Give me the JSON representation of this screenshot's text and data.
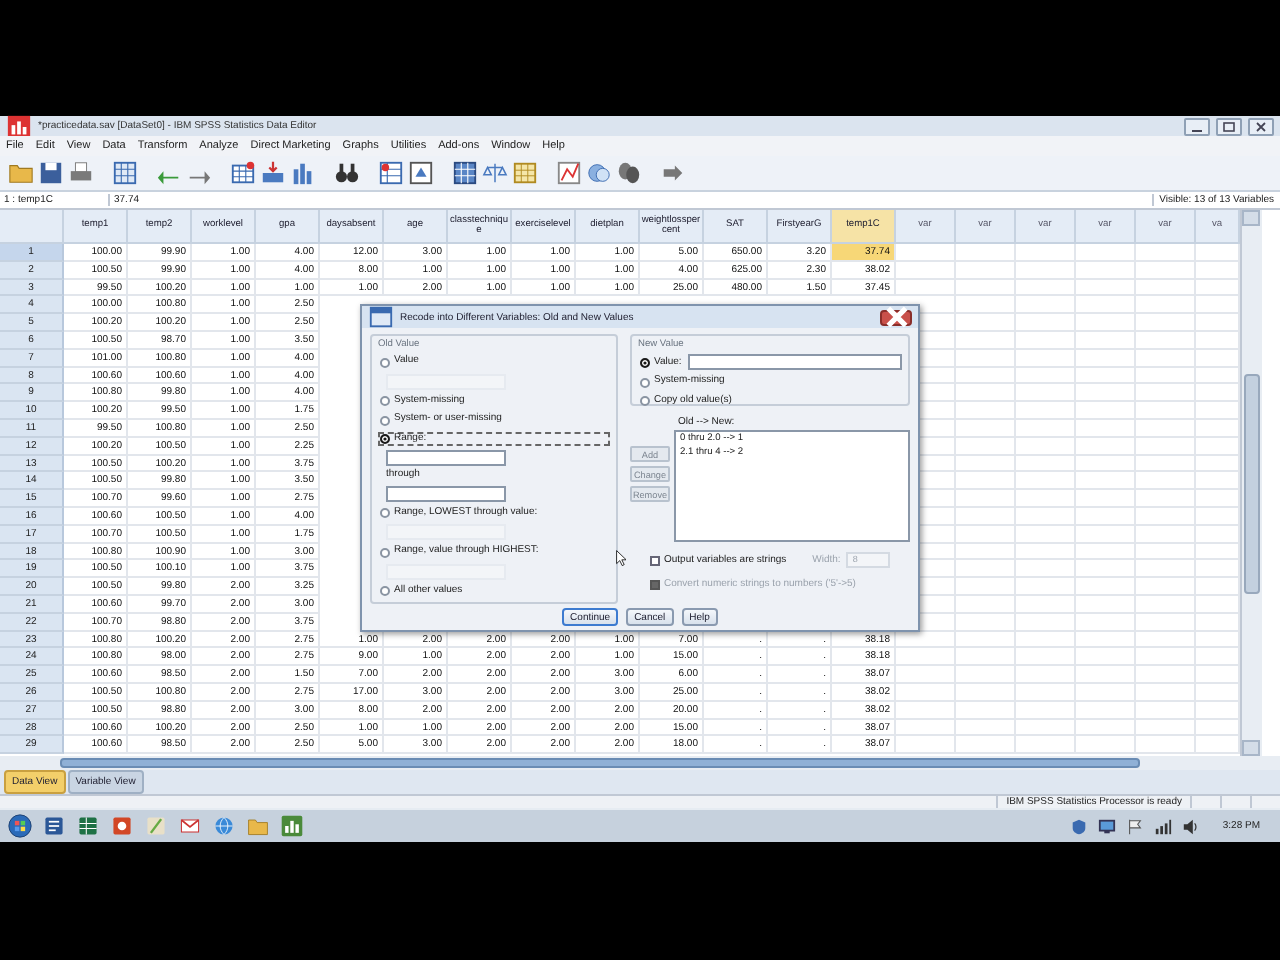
{
  "window": {
    "title": "*practicedata.sav [DataSet0] - IBM SPSS Statistics Data Editor"
  },
  "menu": [
    "File",
    "Edit",
    "View",
    "Data",
    "Transform",
    "Analyze",
    "Direct Marketing",
    "Graphs",
    "Utilities",
    "Add-ons",
    "Window",
    "Help"
  ],
  "cell_editor": {
    "cell": "1 : temp1C",
    "value": "37.74",
    "visible": "Visible: 13 of 13 Variables"
  },
  "table": {
    "columns": [
      {
        "label": "temp1",
        "selected": false,
        "kind": "variable"
      },
      {
        "label": "temp2",
        "selected": false,
        "kind": "variable"
      },
      {
        "label": "worklevel",
        "selected": false,
        "kind": "variable"
      },
      {
        "label": "gpa",
        "selected": false,
        "kind": "variable"
      },
      {
        "label": "daysabsent",
        "selected": false,
        "kind": "variable"
      },
      {
        "label": "age",
        "selected": false,
        "kind": "variable"
      },
      {
        "label": "classtechnique",
        "selected": false,
        "kind": "variable"
      },
      {
        "label": "exerciselevel",
        "selected": false,
        "kind": "variable"
      },
      {
        "label": "dietplan",
        "selected": false,
        "kind": "variable"
      },
      {
        "label": "weightlosspercent",
        "selected": false,
        "kind": "variable"
      },
      {
        "label": "SAT",
        "selected": false,
        "kind": "variable"
      },
      {
        "label": "FirstyearG",
        "selected": false,
        "kind": "variable"
      },
      {
        "label": "temp1C",
        "selected": true,
        "kind": "variable"
      },
      {
        "label": "var",
        "selected": false,
        "kind": "placeholder"
      },
      {
        "label": "var",
        "selected": false,
        "kind": "placeholder"
      },
      {
        "label": "var",
        "selected": false,
        "kind": "placeholder"
      },
      {
        "label": "var",
        "selected": false,
        "kind": "placeholder"
      },
      {
        "label": "var",
        "selected": false,
        "kind": "placeholder"
      },
      {
        "label": "va",
        "selected": false,
        "kind": "placeholder"
      }
    ],
    "rows": [
      {
        "number": "1",
        "selected": true,
        "cells": [
          "100.00",
          "99.90",
          "1.00",
          "4.00",
          "12.00",
          "3.00",
          "1.00",
          "1.00",
          "1.00",
          "5.00",
          "650.00",
          "3.20",
          "37.74"
        ]
      },
      {
        "number": "2",
        "selected": false,
        "cells": [
          "100.50",
          "99.90",
          "1.00",
          "4.00",
          "8.00",
          "1.00",
          "1.00",
          "1.00",
          "1.00",
          "4.00",
          "625.00",
          "2.30",
          "38.02"
        ]
      },
      {
        "number": "3",
        "selected": false,
        "cells": [
          "99.50",
          "100.20",
          "1.00",
          "1.00",
          "1.00",
          "2.00",
          "1.00",
          "1.00",
          "1.00",
          "25.00",
          "480.00",
          "1.50",
          "37.45"
        ]
      },
      {
        "number": "4",
        "selected": false,
        "cells": [
          "100.00",
          "100.80",
          "1.00",
          "2.50"
        ]
      },
      {
        "number": "5",
        "selected": false,
        "cells": [
          "100.20",
          "100.20",
          "1.00",
          "2.50"
        ]
      },
      {
        "number": "6",
        "selected": false,
        "cells": [
          "100.50",
          "98.70",
          "1.00",
          "3.50"
        ]
      },
      {
        "number": "7",
        "selected": false,
        "cells": [
          "101.00",
          "100.80",
          "1.00",
          "4.00"
        ]
      },
      {
        "number": "8",
        "selected": false,
        "cells": [
          "100.60",
          "100.60",
          "1.00",
          "4.00"
        ]
      },
      {
        "number": "9",
        "selected": false,
        "cells": [
          "100.80",
          "99.80",
          "1.00",
          "4.00"
        ]
      },
      {
        "number": "10",
        "selected": false,
        "cells": [
          "100.20",
          "99.50",
          "1.00",
          "1.75"
        ]
      },
      {
        "number": "11",
        "selected": false,
        "cells": [
          "99.50",
          "100.80",
          "1.00",
          "2.50"
        ]
      },
      {
        "number": "12",
        "selected": false,
        "cells": [
          "100.20",
          "100.50",
          "1.00",
          "2.25"
        ]
      },
      {
        "number": "13",
        "selected": false,
        "cells": [
          "100.50",
          "100.20",
          "1.00",
          "3.75"
        ]
      },
      {
        "number": "14",
        "selected": false,
        "cells": [
          "100.50",
          "99.80",
          "1.00",
          "3.50"
        ]
      },
      {
        "number": "15",
        "selected": false,
        "cells": [
          "100.70",
          "99.60",
          "1.00",
          "2.75"
        ]
      },
      {
        "number": "16",
        "selected": false,
        "cells": [
          "100.60",
          "100.50",
          "1.00",
          "4.00"
        ]
      },
      {
        "number": "17",
        "selected": false,
        "cells": [
          "100.70",
          "100.50",
          "1.00",
          "1.75"
        ]
      },
      {
        "number": "18",
        "selected": false,
        "cells": [
          "100.80",
          "100.90",
          "1.00",
          "3.00"
        ]
      },
      {
        "number": "19",
        "selected": false,
        "cells": [
          "100.50",
          "100.10",
          "1.00",
          "3.75"
        ]
      },
      {
        "number": "20",
        "selected": false,
        "cells": [
          "100.50",
          "99.80",
          "2.00",
          "3.25"
        ]
      },
      {
        "number": "21",
        "selected": false,
        "cells": [
          "100.60",
          "99.70",
          "2.00",
          "3.00"
        ]
      },
      {
        "number": "22",
        "selected": false,
        "cells": [
          "100.70",
          "98.80",
          "2.00",
          "3.75"
        ]
      },
      {
        "number": "23",
        "selected": false,
        "cells": [
          "100.80",
          "100.20",
          "2.00",
          "2.75",
          "1.00",
          "2.00",
          "2.00",
          "2.00",
          "1.00",
          "7.00",
          ".",
          ".",
          "38.18"
        ]
      },
      {
        "number": "24",
        "selected": false,
        "cells": [
          "100.80",
          "98.00",
          "2.00",
          "2.75",
          "9.00",
          "1.00",
          "2.00",
          "2.00",
          "1.00",
          "15.00",
          ".",
          ".",
          "38.18"
        ]
      },
      {
        "number": "25",
        "selected": false,
        "cells": [
          "100.60",
          "98.50",
          "2.00",
          "1.50",
          "7.00",
          "2.00",
          "2.00",
          "2.00",
          "3.00",
          "6.00",
          ".",
          ".",
          "38.07"
        ]
      },
      {
        "number": "26",
        "selected": false,
        "cells": [
          "100.50",
          "100.80",
          "2.00",
          "2.75",
          "17.00",
          "3.00",
          "2.00",
          "2.00",
          "3.00",
          "25.00",
          ".",
          ".",
          "38.02"
        ]
      },
      {
        "number": "27",
        "selected": false,
        "cells": [
          "100.50",
          "98.80",
          "2.00",
          "3.00",
          "8.00",
          "2.00",
          "2.00",
          "2.00",
          "2.00",
          "20.00",
          ".",
          ".",
          "38.02"
        ]
      },
      {
        "number": "28",
        "selected": false,
        "cells": [
          "100.60",
          "100.20",
          "2.00",
          "2.50",
          "1.00",
          "1.00",
          "2.00",
          "2.00",
          "2.00",
          "15.00",
          ".",
          ".",
          "38.07"
        ]
      },
      {
        "number": "29",
        "selected": false,
        "cells": [
          "100.60",
          "98.50",
          "2.00",
          "2.50",
          "5.00",
          "3.00",
          "2.00",
          "2.00",
          "2.00",
          "18.00",
          ".",
          ".",
          "38.07"
        ]
      }
    ]
  },
  "view_tabs": [
    {
      "label": "Data View",
      "selected": true
    },
    {
      "label": "Variable View",
      "selected": false
    }
  ],
  "status_bar": "IBM SPSS Statistics Processor is ready",
  "dialog": {
    "title": "Recode into Different Variables: Old and New Values",
    "old_value": {
      "label": "Old Value",
      "items": [
        {
          "kind": "radio",
          "label": "Value",
          "selected": false,
          "focused": false
        },
        {
          "kind": "field",
          "disabled": true
        },
        {
          "kind": "radio",
          "label": "System-missing",
          "selected": false,
          "focused": false
        },
        {
          "kind": "radio",
          "label": "System- or user-missing",
          "selected": false,
          "focused": false
        },
        {
          "kind": "radio",
          "label": "Range:",
          "selected": true,
          "focused": true
        },
        {
          "kind": "field",
          "disabled": false
        },
        {
          "kind": "text",
          "label": "through"
        },
        {
          "kind": "field",
          "disabled": false
        },
        {
          "kind": "radio",
          "label": "Range, LOWEST through value:",
          "selected": false,
          "focused": false
        },
        {
          "kind": "field",
          "disabled": true
        },
        {
          "kind": "radio",
          "label": "Range, value through HIGHEST:",
          "selected": false,
          "focused": false
        },
        {
          "kind": "field",
          "disabled": true
        },
        {
          "kind": "radio",
          "label": "All other values",
          "selected": false,
          "focused": false
        }
      ]
    },
    "new_value": {
      "label": "New Value",
      "items": [
        {
          "kind": "radio_with_field",
          "label": "Value:",
          "selected": true
        },
        {
          "kind": "radio",
          "label": "System-missing",
          "selected": false
        },
        {
          "kind": "radio",
          "label": "Copy old value(s)",
          "selected": false
        }
      ]
    },
    "side_buttons": [
      {
        "label": "Add",
        "disabled": true
      },
      {
        "label": "Change",
        "disabled": true
      },
      {
        "label": "Remove",
        "disabled": true
      }
    ],
    "list_label": "Old --> New:",
    "list_items": [
      "0 thru 2.0 --> 1",
      "2.1 thru 4 --> 2"
    ],
    "options": [
      {
        "label": "Output variables are strings",
        "checked": false,
        "disabled": false
      },
      {
        "label": "Convert numeric strings to numbers ('5'->5)",
        "checked": false,
        "disabled": true
      }
    ],
    "width": {
      "label": "Width:",
      "value": "8",
      "disabled": true
    },
    "buttons": [
      "Continue",
      "Cancel",
      "Help"
    ]
  },
  "taskbar": {
    "time": "3:28 PM"
  }
}
